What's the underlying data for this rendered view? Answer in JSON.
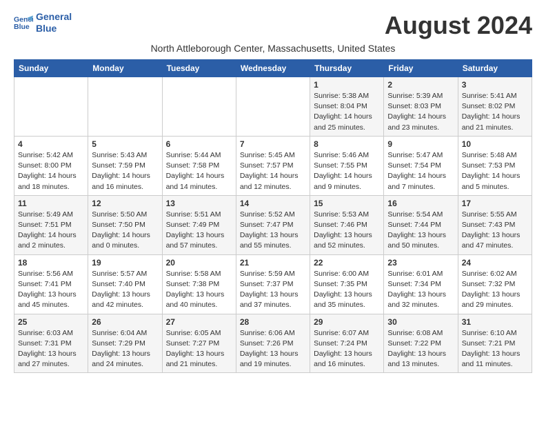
{
  "logo": {
    "line1": "General",
    "line2": "Blue"
  },
  "title": "August 2024",
  "subtitle": "North Attleborough Center, Massachusetts, United States",
  "headers": [
    "Sunday",
    "Monday",
    "Tuesday",
    "Wednesday",
    "Thursday",
    "Friday",
    "Saturday"
  ],
  "weeks": [
    [
      {
        "day": "",
        "info": ""
      },
      {
        "day": "",
        "info": ""
      },
      {
        "day": "",
        "info": ""
      },
      {
        "day": "",
        "info": ""
      },
      {
        "day": "1",
        "info": "Sunrise: 5:38 AM\nSunset: 8:04 PM\nDaylight: 14 hours\nand 25 minutes."
      },
      {
        "day": "2",
        "info": "Sunrise: 5:39 AM\nSunset: 8:03 PM\nDaylight: 14 hours\nand 23 minutes."
      },
      {
        "day": "3",
        "info": "Sunrise: 5:41 AM\nSunset: 8:02 PM\nDaylight: 14 hours\nand 21 minutes."
      }
    ],
    [
      {
        "day": "4",
        "info": "Sunrise: 5:42 AM\nSunset: 8:00 PM\nDaylight: 14 hours\nand 18 minutes."
      },
      {
        "day": "5",
        "info": "Sunrise: 5:43 AM\nSunset: 7:59 PM\nDaylight: 14 hours\nand 16 minutes."
      },
      {
        "day": "6",
        "info": "Sunrise: 5:44 AM\nSunset: 7:58 PM\nDaylight: 14 hours\nand 14 minutes."
      },
      {
        "day": "7",
        "info": "Sunrise: 5:45 AM\nSunset: 7:57 PM\nDaylight: 14 hours\nand 12 minutes."
      },
      {
        "day": "8",
        "info": "Sunrise: 5:46 AM\nSunset: 7:55 PM\nDaylight: 14 hours\nand 9 minutes."
      },
      {
        "day": "9",
        "info": "Sunrise: 5:47 AM\nSunset: 7:54 PM\nDaylight: 14 hours\nand 7 minutes."
      },
      {
        "day": "10",
        "info": "Sunrise: 5:48 AM\nSunset: 7:53 PM\nDaylight: 14 hours\nand 5 minutes."
      }
    ],
    [
      {
        "day": "11",
        "info": "Sunrise: 5:49 AM\nSunset: 7:51 PM\nDaylight: 14 hours\nand 2 minutes."
      },
      {
        "day": "12",
        "info": "Sunrise: 5:50 AM\nSunset: 7:50 PM\nDaylight: 14 hours\nand 0 minutes."
      },
      {
        "day": "13",
        "info": "Sunrise: 5:51 AM\nSunset: 7:49 PM\nDaylight: 13 hours\nand 57 minutes."
      },
      {
        "day": "14",
        "info": "Sunrise: 5:52 AM\nSunset: 7:47 PM\nDaylight: 13 hours\nand 55 minutes."
      },
      {
        "day": "15",
        "info": "Sunrise: 5:53 AM\nSunset: 7:46 PM\nDaylight: 13 hours\nand 52 minutes."
      },
      {
        "day": "16",
        "info": "Sunrise: 5:54 AM\nSunset: 7:44 PM\nDaylight: 13 hours\nand 50 minutes."
      },
      {
        "day": "17",
        "info": "Sunrise: 5:55 AM\nSunset: 7:43 PM\nDaylight: 13 hours\nand 47 minutes."
      }
    ],
    [
      {
        "day": "18",
        "info": "Sunrise: 5:56 AM\nSunset: 7:41 PM\nDaylight: 13 hours\nand 45 minutes."
      },
      {
        "day": "19",
        "info": "Sunrise: 5:57 AM\nSunset: 7:40 PM\nDaylight: 13 hours\nand 42 minutes."
      },
      {
        "day": "20",
        "info": "Sunrise: 5:58 AM\nSunset: 7:38 PM\nDaylight: 13 hours\nand 40 minutes."
      },
      {
        "day": "21",
        "info": "Sunrise: 5:59 AM\nSunset: 7:37 PM\nDaylight: 13 hours\nand 37 minutes."
      },
      {
        "day": "22",
        "info": "Sunrise: 6:00 AM\nSunset: 7:35 PM\nDaylight: 13 hours\nand 35 minutes."
      },
      {
        "day": "23",
        "info": "Sunrise: 6:01 AM\nSunset: 7:34 PM\nDaylight: 13 hours\nand 32 minutes."
      },
      {
        "day": "24",
        "info": "Sunrise: 6:02 AM\nSunset: 7:32 PM\nDaylight: 13 hours\nand 29 minutes."
      }
    ],
    [
      {
        "day": "25",
        "info": "Sunrise: 6:03 AM\nSunset: 7:31 PM\nDaylight: 13 hours\nand 27 minutes."
      },
      {
        "day": "26",
        "info": "Sunrise: 6:04 AM\nSunset: 7:29 PM\nDaylight: 13 hours\nand 24 minutes."
      },
      {
        "day": "27",
        "info": "Sunrise: 6:05 AM\nSunset: 7:27 PM\nDaylight: 13 hours\nand 21 minutes."
      },
      {
        "day": "28",
        "info": "Sunrise: 6:06 AM\nSunset: 7:26 PM\nDaylight: 13 hours\nand 19 minutes."
      },
      {
        "day": "29",
        "info": "Sunrise: 6:07 AM\nSunset: 7:24 PM\nDaylight: 13 hours\nand 16 minutes."
      },
      {
        "day": "30",
        "info": "Sunrise: 6:08 AM\nSunset: 7:22 PM\nDaylight: 13 hours\nand 13 minutes."
      },
      {
        "day": "31",
        "info": "Sunrise: 6:10 AM\nSunset: 7:21 PM\nDaylight: 13 hours\nand 11 minutes."
      }
    ]
  ]
}
